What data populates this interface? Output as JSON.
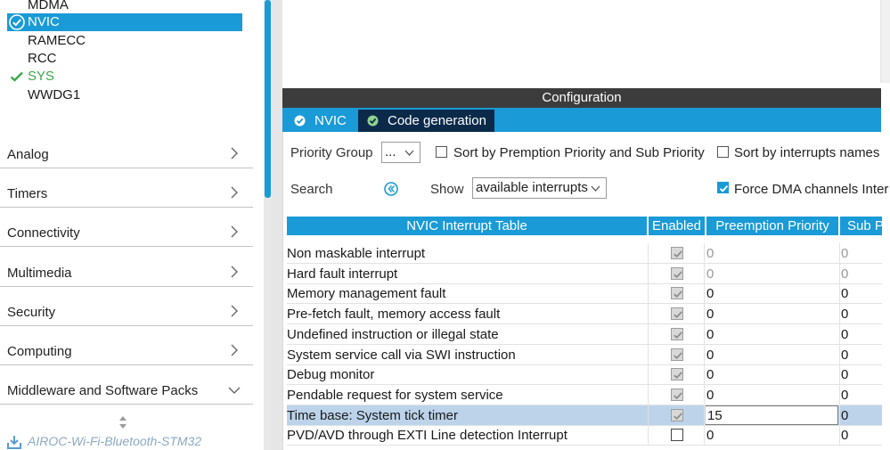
{
  "sidebar": {
    "peripherals": [
      {
        "label": "MDMA",
        "state": "normal"
      },
      {
        "label": "NVIC",
        "state": "selected"
      },
      {
        "label": "RAMECC",
        "state": "normal"
      },
      {
        "label": "RCC",
        "state": "normal"
      },
      {
        "label": "SYS",
        "state": "configured"
      },
      {
        "label": "WWDG1",
        "state": "normal"
      }
    ],
    "categories": [
      {
        "label": "Analog"
      },
      {
        "label": "Timers"
      },
      {
        "label": "Connectivity"
      },
      {
        "label": "Multimedia"
      },
      {
        "label": "Security"
      },
      {
        "label": "Computing"
      },
      {
        "label": "Middleware and Software Packs"
      }
    ],
    "plugin_label": "AIROC-Wi-Fi-Bluetooth-STM32"
  },
  "config": {
    "title": "Configuration",
    "tabs": [
      {
        "label": "NVIC",
        "active": false
      },
      {
        "label": "Code generation",
        "active": true
      }
    ],
    "priority_group_label": "Priority Group",
    "priority_group_value": "...",
    "sort_premption_label": "Sort by Premption Priority and Sub Priority",
    "sort_names_label": "Sort by interrupts names",
    "search_label": "Search",
    "show_label": "Show",
    "show_value": "available interrupts",
    "force_dma_label": "Force DMA channels Inter",
    "force_dma_checked": true,
    "sort_premption_checked": false,
    "sort_names_checked": false
  },
  "table": {
    "headers": [
      "NVIC Interrupt Table",
      "Enabled",
      "Preemption Priority",
      "Sub P"
    ],
    "rows": [
      {
        "name": "Non maskable interrupt",
        "enabled": true,
        "locked": true,
        "preemption": "0",
        "sub": "0"
      },
      {
        "name": "Hard fault interrupt",
        "enabled": true,
        "locked": true,
        "preemption": "0",
        "sub": "0"
      },
      {
        "name": "Memory management fault",
        "enabled": true,
        "locked": false,
        "preemption": "0",
        "sub": "0"
      },
      {
        "name": "Pre-fetch fault, memory access fault",
        "enabled": true,
        "locked": false,
        "preemption": "0",
        "sub": "0"
      },
      {
        "name": "Undefined instruction or illegal state",
        "enabled": true,
        "locked": false,
        "preemption": "0",
        "sub": "0"
      },
      {
        "name": "System service call via SWI instruction",
        "enabled": true,
        "locked": false,
        "preemption": "0",
        "sub": "0"
      },
      {
        "name": "Debug monitor",
        "enabled": true,
        "locked": false,
        "preemption": "0",
        "sub": "0"
      },
      {
        "name": "Pendable request for system service",
        "enabled": true,
        "locked": false,
        "preemption": "0",
        "sub": "0"
      },
      {
        "name": "Time base: System tick timer",
        "enabled": true,
        "locked": false,
        "preemption": "15",
        "sub": "0",
        "selected": true,
        "editing": true
      },
      {
        "name": "PVD/AVD through EXTI Line detection Interrupt",
        "enabled": false,
        "locked": false,
        "preemption": "0",
        "sub": "0"
      }
    ]
  },
  "colors": {
    "accent": "#1a9ad6",
    "configured": "#3aa64a",
    "dark_tab": "#0b2a4a",
    "selected_row": "#bcd3ea"
  }
}
